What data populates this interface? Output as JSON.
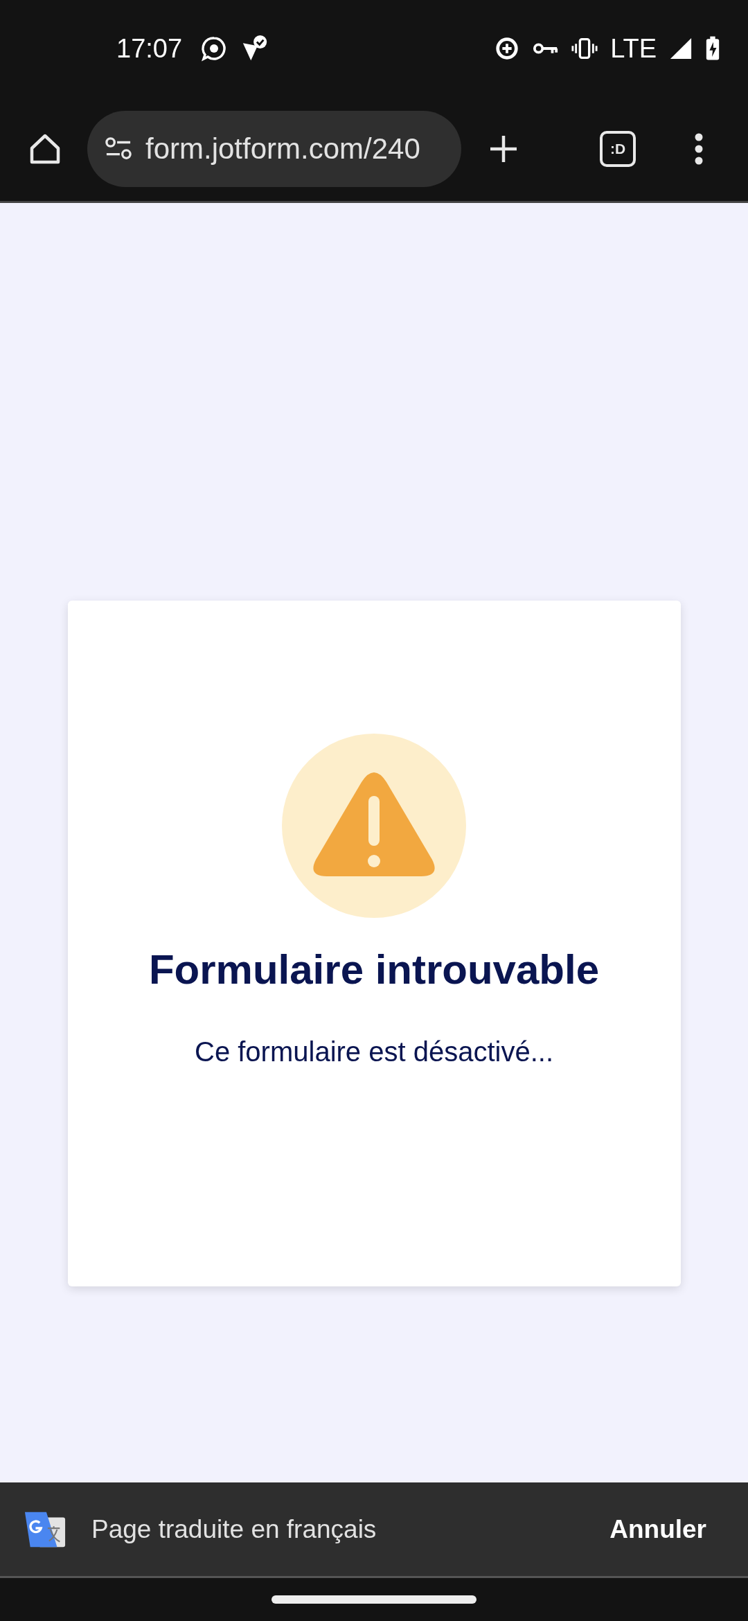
{
  "status_bar": {
    "time": "17:07",
    "network": "LTE"
  },
  "browser_toolbar": {
    "url": "form.jotform.com/240",
    "tab_count": ":D"
  },
  "error_card": {
    "title": "Formulaire introuvable",
    "message": "Ce formulaire est désactivé..."
  },
  "translate_bar": {
    "message": "Page traduite en français",
    "action": "Annuler"
  }
}
